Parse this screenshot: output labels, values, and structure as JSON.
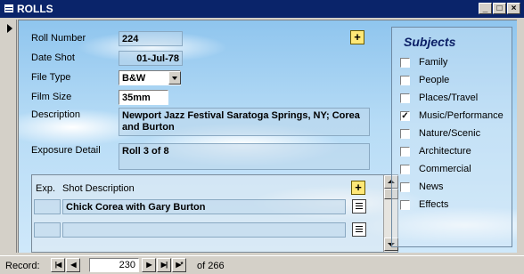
{
  "window": {
    "title": "ROLLS"
  },
  "form": {
    "roll_number": {
      "label": "Roll Number",
      "value": "224"
    },
    "date_shot": {
      "label": "Date Shot",
      "value": "01-Jul-78"
    },
    "file_type": {
      "label": "File Type",
      "value": "B&W"
    },
    "film_size": {
      "label": "Film Size",
      "value": "35mm"
    },
    "description": {
      "label": "Description",
      "value": "Newport Jazz Festival Saratoga Springs, NY; Corea and Burton"
    },
    "exposure_detail": {
      "label": "Exposure Detail",
      "value": "Roll 3 of 8"
    }
  },
  "shots": {
    "columns": [
      "Exp.",
      "Shot Description"
    ],
    "rows": [
      {
        "exp": "",
        "description": "Chick Corea with Gary Burton"
      },
      {
        "exp": "",
        "description": ""
      }
    ]
  },
  "subjects": {
    "title": "Subjects",
    "items": [
      {
        "label": "Family",
        "checked": false
      },
      {
        "label": "People",
        "checked": false
      },
      {
        "label": "Places/Travel",
        "checked": false
      },
      {
        "label": "Music/Performance",
        "checked": true
      },
      {
        "label": "Nature/Scenic",
        "checked": false
      },
      {
        "label": "Architecture",
        "checked": false
      },
      {
        "label": "Commercial",
        "checked": false
      },
      {
        "label": "News",
        "checked": false
      },
      {
        "label": "Effects",
        "checked": false
      }
    ]
  },
  "navigation": {
    "label": "Record:",
    "current": "230",
    "of_text": "of 266",
    "buttons": {
      "first": "|◀",
      "prev": "◀",
      "next": "▶",
      "last": "▶|",
      "new": "▶*"
    }
  },
  "icons": {
    "add": "+",
    "minimize": "_",
    "maximize": "□",
    "close": "×",
    "check": "✓"
  },
  "colors": {
    "titlebar": "#0a246a",
    "sky_top": "#8fc5ee",
    "subjects_title": "#0b1f66"
  }
}
